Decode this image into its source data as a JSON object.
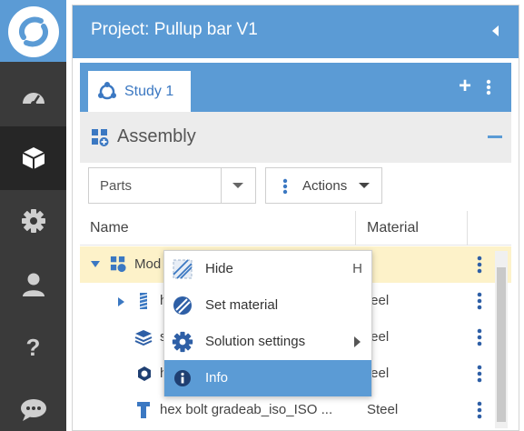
{
  "colors": {
    "accent": "#5b9bd5",
    "rail": "#3a3a3a",
    "selected_row": "#fdf2c9"
  },
  "rail": {
    "items": [
      {
        "icon": "dashboard-icon"
      },
      {
        "icon": "cube-icon",
        "active": true
      },
      {
        "icon": "gear-icon"
      },
      {
        "icon": "user-icon"
      },
      {
        "icon": "help-icon"
      },
      {
        "icon": "chat-icon"
      }
    ]
  },
  "project": {
    "title": "Project: Pullup bar V1"
  },
  "study": {
    "tab_label": "Study 1",
    "add_label": "+"
  },
  "assembly": {
    "title": "Assembly"
  },
  "toolbar": {
    "parts_value": "Parts",
    "actions_label": "Actions"
  },
  "table": {
    "columns": [
      "Name",
      "Material"
    ],
    "rows": [
      {
        "name": "Mod",
        "material": ""
      },
      {
        "name": "h",
        "material": "teel"
      },
      {
        "name": "s",
        "material": "teel"
      },
      {
        "name": "h",
        "material": "teel"
      },
      {
        "name": "hex bolt gradeab_iso_ISO ...",
        "material": "Steel"
      }
    ]
  },
  "context_menu": {
    "items": [
      {
        "label": "Hide",
        "shortcut": "H",
        "icon": "hide-icon"
      },
      {
        "label": "Set material",
        "icon": "material-icon"
      },
      {
        "label": "Solution settings",
        "icon": "settings-icon"
      },
      {
        "label": "Info",
        "icon": "info-icon"
      }
    ]
  }
}
